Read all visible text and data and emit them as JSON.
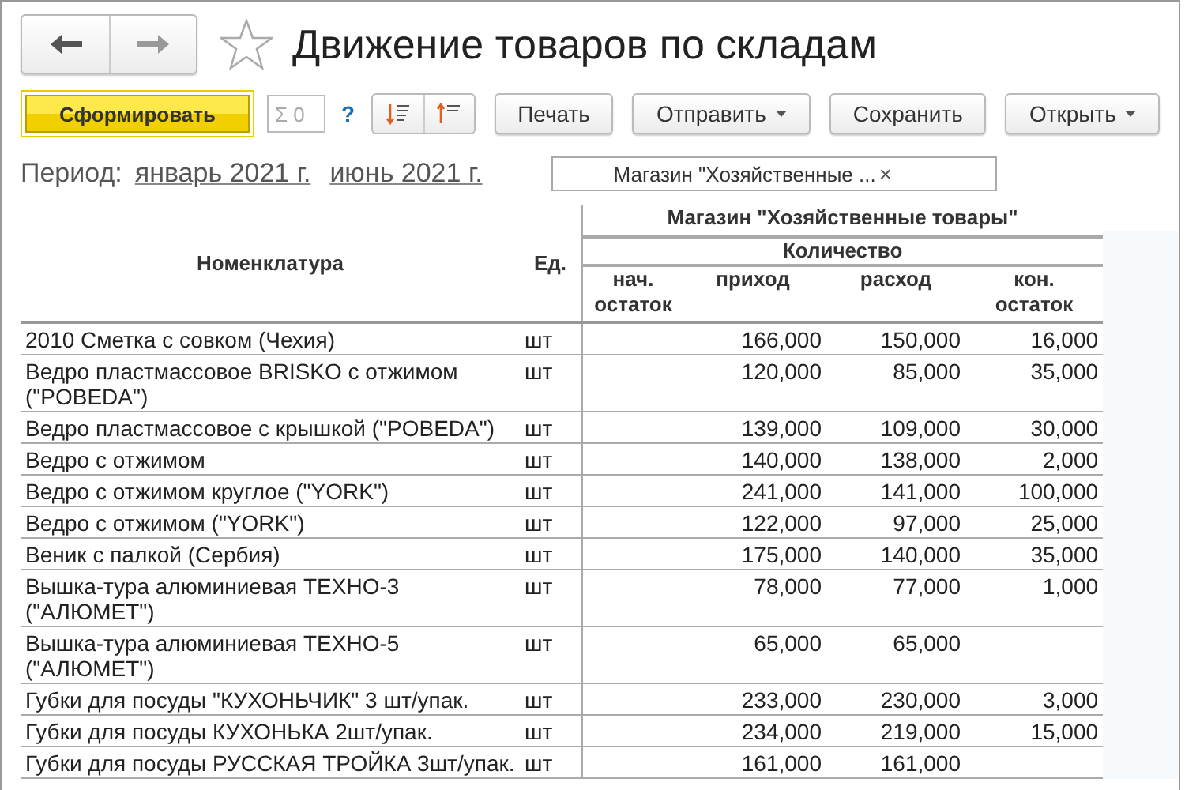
{
  "window": {
    "title": "Движение товаров по складам",
    "favorite": false
  },
  "toolbar": {
    "generate": "Сформировать",
    "sum_field": "Σ 0",
    "help": "?",
    "buttons": [
      {
        "label": "Печать",
        "dropdown": false
      },
      {
        "label": "Отправить",
        "dropdown": true
      },
      {
        "label": "Сохранить",
        "dropdown": false
      },
      {
        "label": "Открыть",
        "dropdown": true
      }
    ]
  },
  "period": {
    "label": "Период:",
    "from": "январь 2021 г.",
    "to": "июнь 2021 г."
  },
  "filter": {
    "value": "Магазин \"Хозяйственные ...",
    "clear": "×"
  },
  "table": {
    "columns": {
      "name": "Номенклатура",
      "unit": "Ед.",
      "group": "Магазин \"Хозяйственные товары\"",
      "subgroup": "Количество",
      "start": "нач. остаток",
      "in": "приход",
      "out": "расход",
      "end": "кон. остаток"
    },
    "rows": [
      {
        "name": "2010 Сметка с совком (Чехия)",
        "unit": "шт",
        "in": "166,000",
        "out": "150,000",
        "end": "16,000"
      },
      {
        "name": "Ведро пластмассовое BRISKO с отжимом (\"POBEDA\")",
        "unit": "шт",
        "in": "120,000",
        "out": "85,000",
        "end": "35,000"
      },
      {
        "name": "Ведро пластмассовое с крышкой (\"POBEDA\")",
        "unit": "шт",
        "in": "139,000",
        "out": "109,000",
        "end": "30,000"
      },
      {
        "name": "Ведро с отжимом",
        "unit": "шт",
        "in": "140,000",
        "out": "138,000",
        "end": "2,000"
      },
      {
        "name": "Ведро с отжимом  круглое (\"YORK\")",
        "unit": "шт",
        "in": "241,000",
        "out": "141,000",
        "end": "100,000"
      },
      {
        "name": "Ведро с отжимом (\"YORK\")",
        "unit": "шт",
        "in": "122,000",
        "out": "97,000",
        "end": "25,000"
      },
      {
        "name": "Веник с палкой (Сербия)",
        "unit": "шт",
        "in": "175,000",
        "out": "140,000",
        "end": "35,000"
      },
      {
        "name": "Вышка-тура алюминиевая ТЕХНО-3 (\"АЛЮМЕТ\")",
        "unit": "шт",
        "in": "78,000",
        "out": "77,000",
        "end": "1,000"
      },
      {
        "name": "Вышка-тура алюминиевая ТЕХНО-5 (\"АЛЮМЕТ\")",
        "unit": "шт",
        "in": "65,000",
        "out": "65,000"
      },
      {
        "name": "Губки для посуды \"КУХОНЬЧИК\" 3 шт/упак.",
        "unit": "шт",
        "in": "233,000",
        "out": "230,000",
        "end": "3,000"
      },
      {
        "name": "Губки для посуды КУХОНЬКА 2шт/упак.",
        "unit": "шт",
        "in": "234,000",
        "out": "219,000",
        "end": "15,000"
      },
      {
        "name": "Губки для посуды РУССКАЯ ТРОЙКА 3шт/упак.",
        "unit": "шт",
        "in": "161,000",
        "out": "161,000"
      }
    ]
  }
}
